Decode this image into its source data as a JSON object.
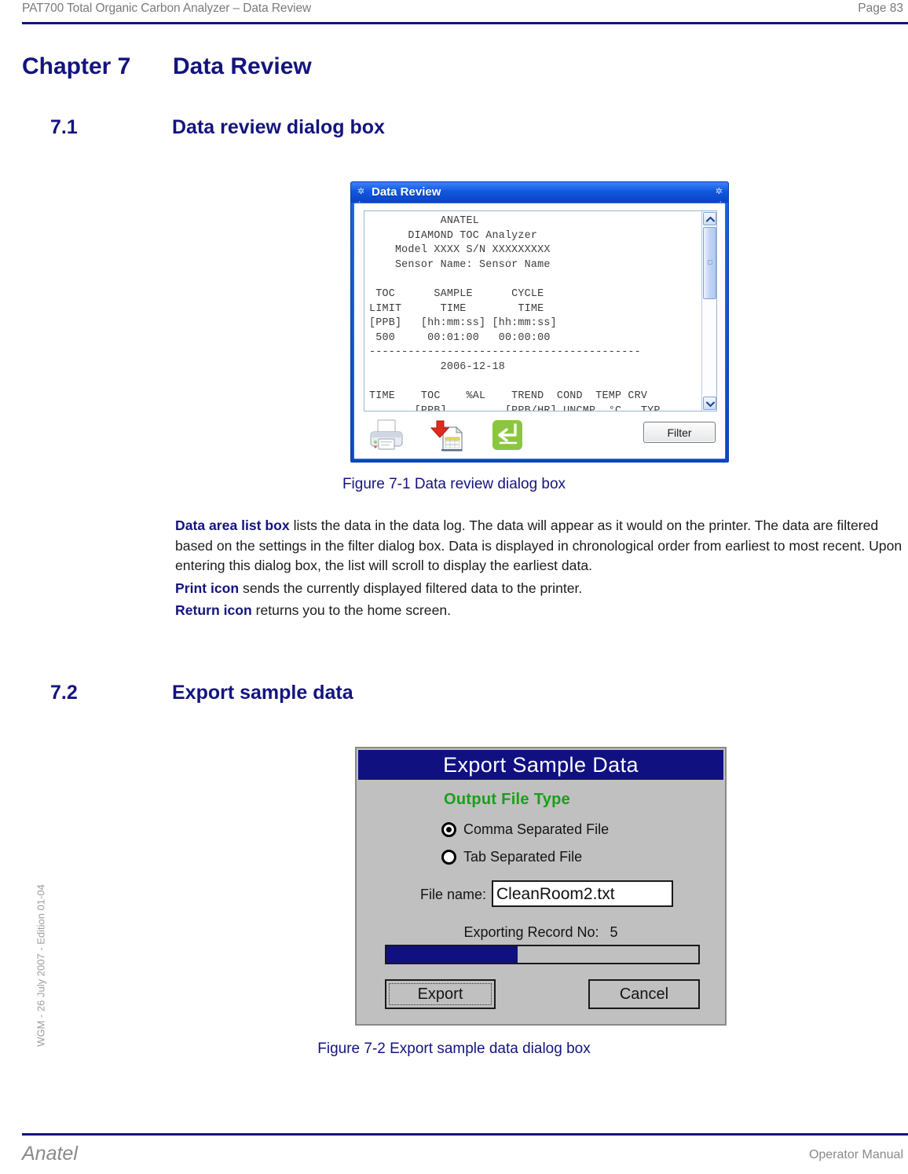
{
  "header": {
    "left_text": "PAT700 Total Organic Carbon Analyzer – Data Review",
    "page_label": "Page 83"
  },
  "footer": {
    "left_text": "Anatel",
    "right_text": "Operator Manual",
    "side_vertical_text": "WGM - 26 July 2007 - Edition 01-04"
  },
  "chapter": {
    "number": "Chapter 7",
    "title": "Data Review"
  },
  "sections": [
    {
      "number": "7.1",
      "title": "Data review dialog box"
    },
    {
      "number": "7.2",
      "title": "Export sample data"
    }
  ],
  "figure1": {
    "caption": "Figure 7-1 Data review dialog box",
    "dialog": {
      "title": "Data Review",
      "listbox_text": "           ANATEL\n      DIAMOND TOC Analyzer\n    Model XXXX S/N XXXXXXXXX\n    Sensor Name: Sensor Name\n\n TOC      SAMPLE      CYCLE\nLIMIT      TIME        TIME\n[PPB]   [hh:mm:ss] [hh:mm:ss]\n 500     00:01:00   00:00:00\n------------------------------------------\n           2006-12-18\n\nTIME    TOC    %AL    TREND  COND  TEMP CRV\n       [PPB]         [PPB/HR] UNCMP  °C   TYP",
      "toolbar": {
        "print_icon": "printer-icon",
        "export_icon": "export-to-file-icon",
        "return_icon": "return-home-icon",
        "filter_label": "Filter"
      },
      "scrollbar": {
        "up_arrow": "chevron-up-icon",
        "down_arrow": "chevron-down-icon"
      }
    }
  },
  "figure2": {
    "caption": "Figure 7-2 Export sample data dialog box",
    "dialog": {
      "title": "Export Sample Data",
      "group_label": "Output File Type",
      "group_label_color": "#18a018",
      "options": [
        {
          "label": "Comma Separated File",
          "selected": true
        },
        {
          "label": "Tab Separated File",
          "selected": false
        }
      ],
      "filename_label": "File name:",
      "filename_value": "CleanRoom2.txt",
      "progress_label": "Exporting Record No:",
      "progress_record_no": "5",
      "progress_percent": 42,
      "progress_color": "#101080",
      "buttons": {
        "export_label": "Export",
        "cancel_label": "Cancel"
      }
    }
  },
  "body": {
    "p1_lead": "Data area list box",
    "p1_rest": " lists the data in the data log. The data will appear as it would on the printer. The data are filtered based on the settings in the filter dialog box. Data is displayed in chronological order from earliest to most recent. Upon entering this dialog box, the list will scroll to display the earliest data.",
    "p2_lead": "Print icon",
    "p2_rest": " sends the currently displayed filtered data to the printer.",
    "p3_lead": "Return icon",
    "p3_rest": " returns you to the home screen."
  },
  "theme": {
    "accent_navy": "#14147e",
    "dialog_blue": "#1158e0",
    "gray_text": "#7a7a7a"
  }
}
